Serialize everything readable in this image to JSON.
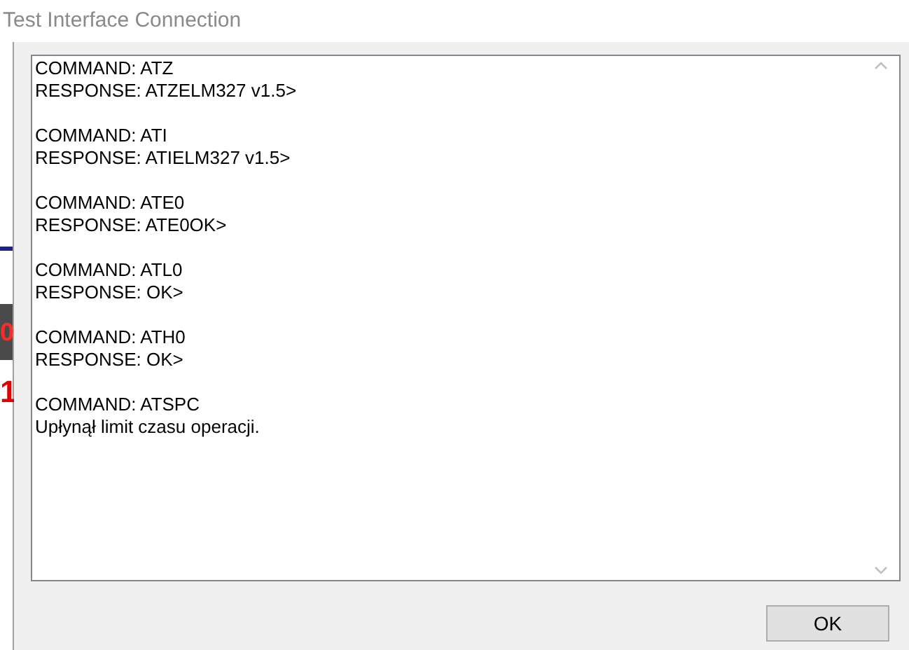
{
  "window": {
    "title": "Test Interface Connection"
  },
  "background_fragments": [
    "0",
    "1"
  ],
  "log_entries": [
    [
      "COMMAND: ATZ",
      "RESPONSE: ATZELM327 v1.5>"
    ],
    [
      "COMMAND: ATI",
      "RESPONSE: ATIELM327 v1.5>"
    ],
    [
      "COMMAND: ATE0",
      "RESPONSE: ATE0OK>"
    ],
    [
      "COMMAND: ATL0",
      "RESPONSE: OK>"
    ],
    [
      "COMMAND: ATH0",
      "RESPONSE: OK>"
    ],
    [
      "COMMAND: ATSPC",
      "Upłynął limit czasu operacji."
    ]
  ],
  "buttons": [
    "OK"
  ]
}
